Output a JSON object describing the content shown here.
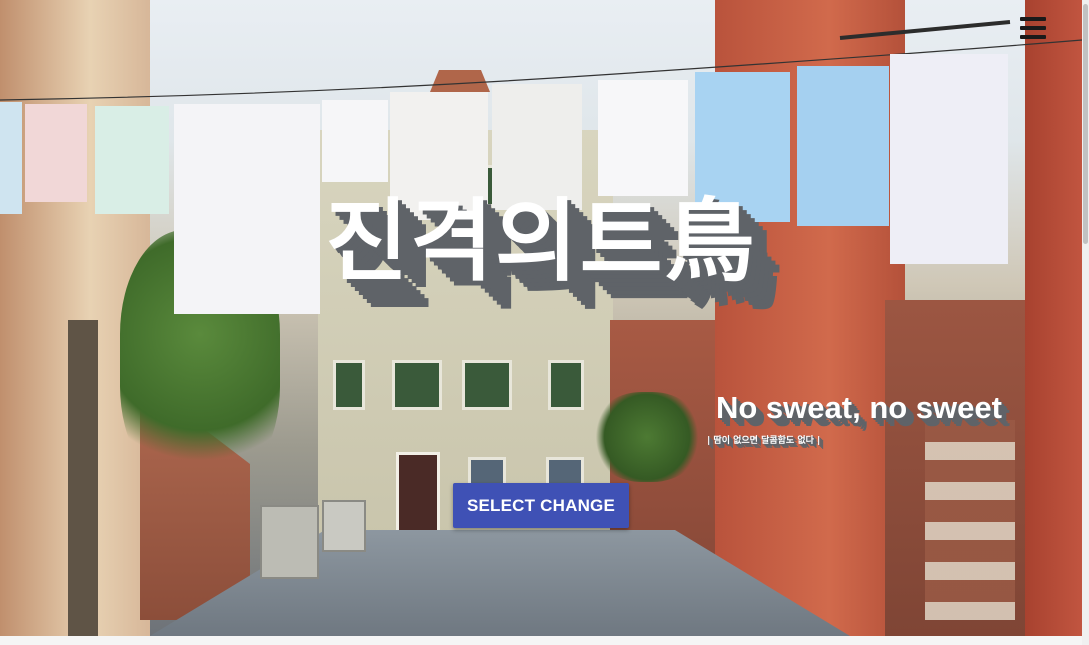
{
  "hero": {
    "title": "진격의트鳥",
    "slogan": "No sweat, no sweet",
    "subtitle": "| 땀이 없으면 달콤함도 없다 |",
    "button_label": "SELECT CHANGE"
  },
  "icons": {
    "menu": "hamburger-menu-icon"
  },
  "colors": {
    "button": "#3f51b5",
    "text": "#ffffff",
    "text_shadow": "#5f6368"
  }
}
